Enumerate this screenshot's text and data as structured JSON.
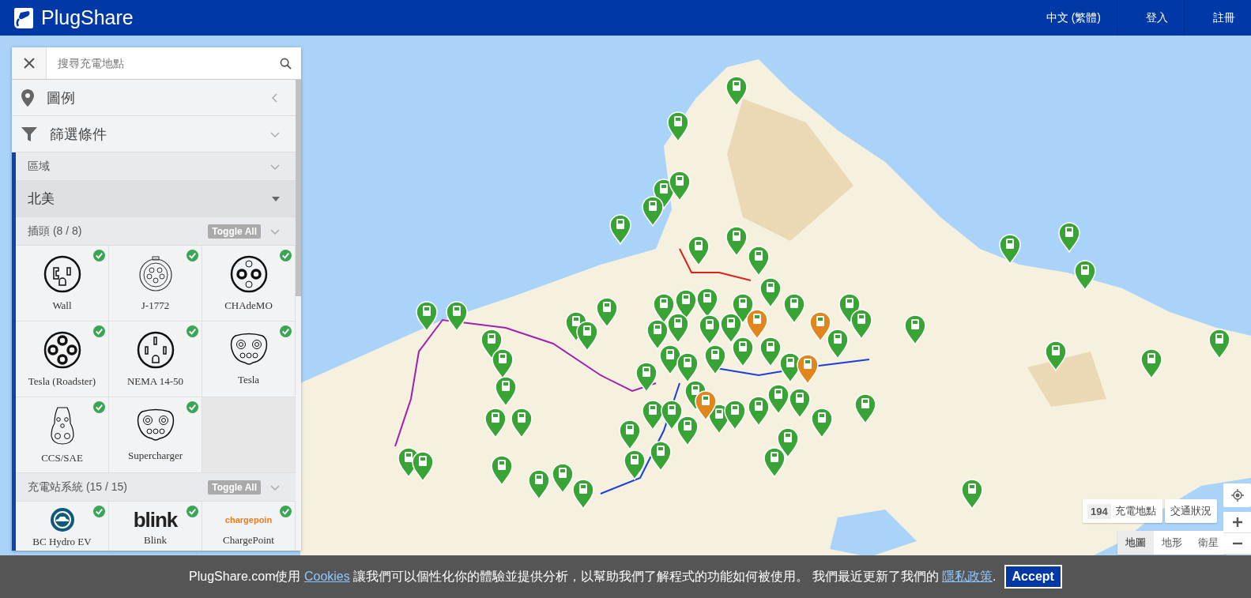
{
  "header": {
    "brand": "PlugShare",
    "nav": [
      {
        "label": "中文 (繁體)"
      },
      {
        "label": "登入"
      },
      {
        "label": "註冊"
      }
    ]
  },
  "search": {
    "placeholder": "搜尋充電地點"
  },
  "panels": [
    {
      "kind": "legend",
      "label": "圖例",
      "expanded": false
    },
    {
      "kind": "filter",
      "label": "篩選條件",
      "expanded": true
    }
  ],
  "region": {
    "label": "區域",
    "value": "北美"
  },
  "plugs": {
    "title": "插頭 (8 / 8)",
    "toggle": "Toggle All",
    "items": [
      {
        "kind": "wall",
        "label": "Wall",
        "checked": true
      },
      {
        "kind": "j1772",
        "label": "J-1772",
        "checked": true
      },
      {
        "kind": "chademo",
        "label": "CHAdeMO",
        "checked": true
      },
      {
        "kind": "roadster",
        "label": "Tesla (Roadster)",
        "checked": true
      },
      {
        "kind": "nema",
        "label": "NEMA 14-50",
        "checked": true
      },
      {
        "kind": "tesla",
        "label": "Tesla",
        "checked": true
      },
      {
        "kind": "ccs",
        "label": "CCS/SAE",
        "checked": true
      },
      {
        "kind": "tesla",
        "label": "Supercharger",
        "checked": true
      }
    ]
  },
  "networks": {
    "title": "充電站系統 (15 / 15)",
    "toggle": "Toggle All",
    "items": [
      {
        "kind": "bchydro",
        "label": "BC Hydro EV",
        "checked": true
      },
      {
        "kind": "blink",
        "logo": "blink",
        "label": "Blink",
        "checked": true
      },
      {
        "kind": "chargepoint",
        "logo": "chargepoin",
        "label": "ChargePoint",
        "checked": true
      }
    ]
  },
  "map_controls": {
    "count": "194",
    "count_label": "充電地點",
    "traffic": "交通狀況",
    "map_types": [
      {
        "label": "地圖",
        "selected": true
      },
      {
        "label": "地形",
        "selected": false
      },
      {
        "label": "衛星",
        "selected": false
      }
    ]
  },
  "cookie": {
    "before": "PlugShare.com使用 ",
    "link": "Cookies",
    "middle": " 讓我們可以個性化你的體驗並提供分析，以幫助我們了解程式的功能如何被使用。 我們最近更新了我們的 ",
    "policy": "隱私政策",
    "after": ".",
    "button": "Accept"
  }
}
